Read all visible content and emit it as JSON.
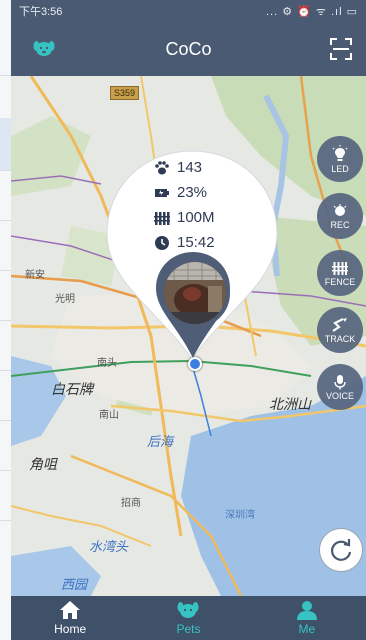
{
  "status_bar": {
    "time": "下午3:56",
    "icons": "... ⚙ ⏰ ᯤ .ıl ▭"
  },
  "app_bar": {
    "title": "CoCo"
  },
  "map": {
    "route_badge": "S359",
    "labels": {
      "xinan": "新安",
      "guangming": "光明",
      "baishizhou": "白石牌",
      "nantou": "南头",
      "nanshan": "南山",
      "houhai": "后海",
      "beizhou_shan": "北洲山",
      "jiaozui": "角咀",
      "shuiwan": "水湾头",
      "tanzhao": "招商",
      "xixiang": "西园",
      "shenzhen_bay": "深圳湾"
    }
  },
  "pet_info": {
    "steps": "143",
    "battery": "23%",
    "fence_radius": "100M",
    "time": "15:42"
  },
  "actions": {
    "led": "LED",
    "rec": "REC",
    "fence": "FENCE",
    "track": "TRACK",
    "voice": "VOICE"
  },
  "bottom_nav": {
    "home": "Home",
    "pets": "Pets",
    "me": "Me"
  },
  "colors": {
    "primary": "#4b5a73",
    "accent": "#35c4c1",
    "pin_dark": "#4f5d77"
  }
}
